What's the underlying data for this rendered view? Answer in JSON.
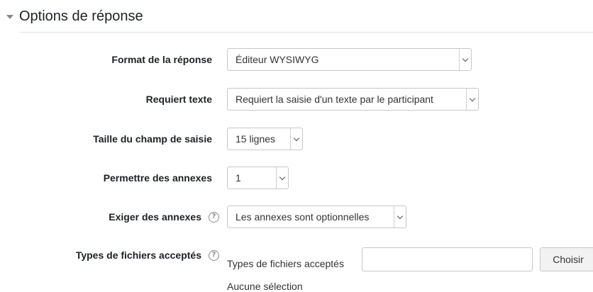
{
  "section": {
    "title": "Options de réponse"
  },
  "fields": {
    "response_format": {
      "label": "Format de la réponse",
      "value": "Éditeur WYSIWYG"
    },
    "require_text": {
      "label": "Requiert texte",
      "value": "Requiert la saisie d'un texte par le participant"
    },
    "input_size": {
      "label": "Taille du champ de saisie",
      "value": "15 lignes"
    },
    "attachments_allowed": {
      "label": "Permettre des annexes",
      "value": "1"
    },
    "attachments_required": {
      "label": "Exiger des annexes",
      "value": "Les annexes sont optionnelles"
    },
    "accepted_filetypes": {
      "label": "Types de fichiers acceptés",
      "inline_label": "Types de fichiers acceptés",
      "value": "",
      "choose_label": "Choisir",
      "no_selection": "Aucune sélection"
    }
  },
  "icons": {
    "help": "?"
  }
}
